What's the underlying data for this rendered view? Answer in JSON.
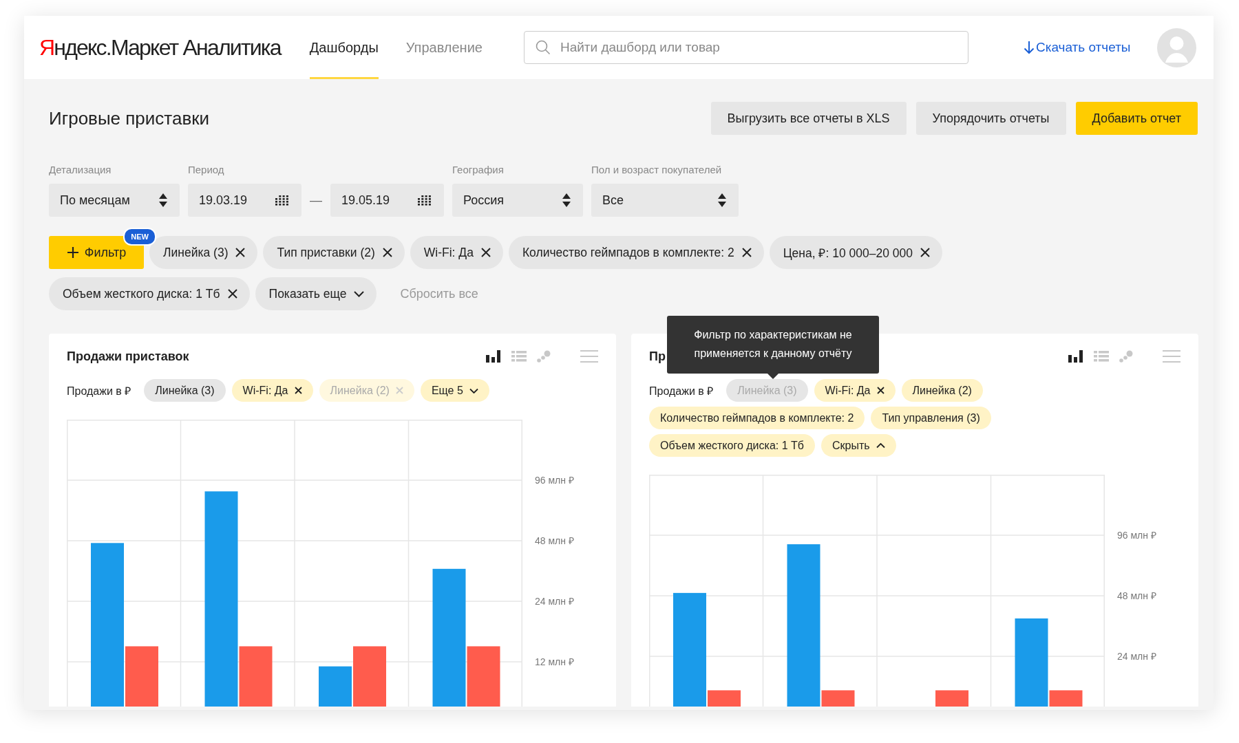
{
  "header": {
    "logo": "Яндекс.Маркет Аналитика",
    "nav": [
      {
        "label": "Дашборды",
        "selected": true
      },
      {
        "label": "Управление",
        "selected": false
      }
    ],
    "search": {
      "placeholder": "Найти дашборд или товар"
    },
    "download_link": "Скачать отчеты"
  },
  "page": {
    "title": "Игровые приставки",
    "buttons": [
      {
        "label": "Выгрузить все отчеты в XLS",
        "kind": "secondary"
      },
      {
        "label": "Упорядочить отчеты",
        "kind": "secondary"
      },
      {
        "label": "Добавить отчет",
        "kind": "primary"
      }
    ]
  },
  "filters": {
    "selects": [
      {
        "label": "Детализация",
        "kind": "select",
        "value": "По месяцам"
      },
      {
        "label": "Период",
        "kind": "date",
        "value": "19.03.19"
      },
      {
        "kind": "date",
        "value": "19.05.19",
        "separator": "—"
      },
      {
        "label": "География",
        "kind": "select",
        "value": "Россия"
      },
      {
        "label": "Пол и возраст покупателей",
        "kind": "select",
        "value": "Все"
      }
    ],
    "add_filter": {
      "label": "Фильтр",
      "badge": "NEW"
    },
    "chips": [
      {
        "label": "Линейка (3)",
        "kind": "chip"
      },
      {
        "label": "Тип приставки (2)",
        "kind": "chip"
      },
      {
        "label": "Wi-Fi: Да",
        "kind": "chip"
      },
      {
        "label": "Количество геймпадов в комплекте: 2",
        "kind": "chip"
      },
      {
        "label": "Цена, ₽: 10 000–20 000",
        "kind": "chip"
      },
      {
        "label": "Объем жесткого диска: 1 Тб",
        "kind": "chip"
      },
      {
        "label": "Показать еще",
        "kind": "more",
        "expanded": false
      }
    ],
    "reset": "Сбросить все"
  },
  "cards": [
    {
      "title": "Продажи приставок",
      "views": [
        {
          "kind": "bar",
          "selected": true
        },
        {
          "kind": "table",
          "selected": false
        },
        {
          "kind": "scatter",
          "selected": false
        }
      ],
      "metric": "Продажи в ₽",
      "chips": [
        {
          "label": "Линейка (3)",
          "kind": "applied",
          "disabled": false,
          "removable": false
        },
        {
          "label": "Wi-Fi: Да",
          "kind": "filter",
          "disabled": false,
          "removable": true
        },
        {
          "label": "Линейка (2)",
          "kind": "filter",
          "disabled": true,
          "removable": true
        },
        {
          "label": "Еще 5",
          "kind": "more",
          "expanded": false
        }
      ],
      "axis_labels": [
        "96 млн ₽",
        "48 млн ₽",
        "24 млн ₽",
        "12 млн ₽"
      ],
      "chart": {
        "kind": "picture"
      }
    },
    {
      "title": "Пр",
      "views": [
        {
          "kind": "bar",
          "selected": true
        },
        {
          "kind": "table",
          "selected": false
        },
        {
          "kind": "scatter",
          "selected": false
        }
      ],
      "tooltip": "Фильтр по характеристикам не применяется к данному отчёту",
      "metric": "Продажи в ₽",
      "chips": [
        {
          "label": "Линейка (3)",
          "kind": "applied",
          "disabled": true,
          "removable": false
        },
        {
          "label": "Wi-Fi: Да",
          "kind": "filter",
          "disabled": false,
          "removable": true
        },
        {
          "label": "Линейка (2)",
          "kind": "filter",
          "disabled": false,
          "removable": false
        },
        {
          "label": "Количество геймпадов в комплекте: 2",
          "kind": "filter",
          "disabled": false,
          "removable": false
        },
        {
          "label": "Тип управления (3)",
          "kind": "filter",
          "disabled": false,
          "removable": false
        },
        {
          "label": "Объем жесткого диска: 1 Тб",
          "kind": "filter",
          "disabled": false,
          "removable": false
        },
        {
          "label": "Скрыть",
          "kind": "more",
          "expanded": true
        }
      ],
      "axis_labels": [
        "96 млн ₽",
        "48 млн ₽",
        "24 млн ₽"
      ],
      "chart": {
        "kind": "picture"
      }
    }
  ]
}
